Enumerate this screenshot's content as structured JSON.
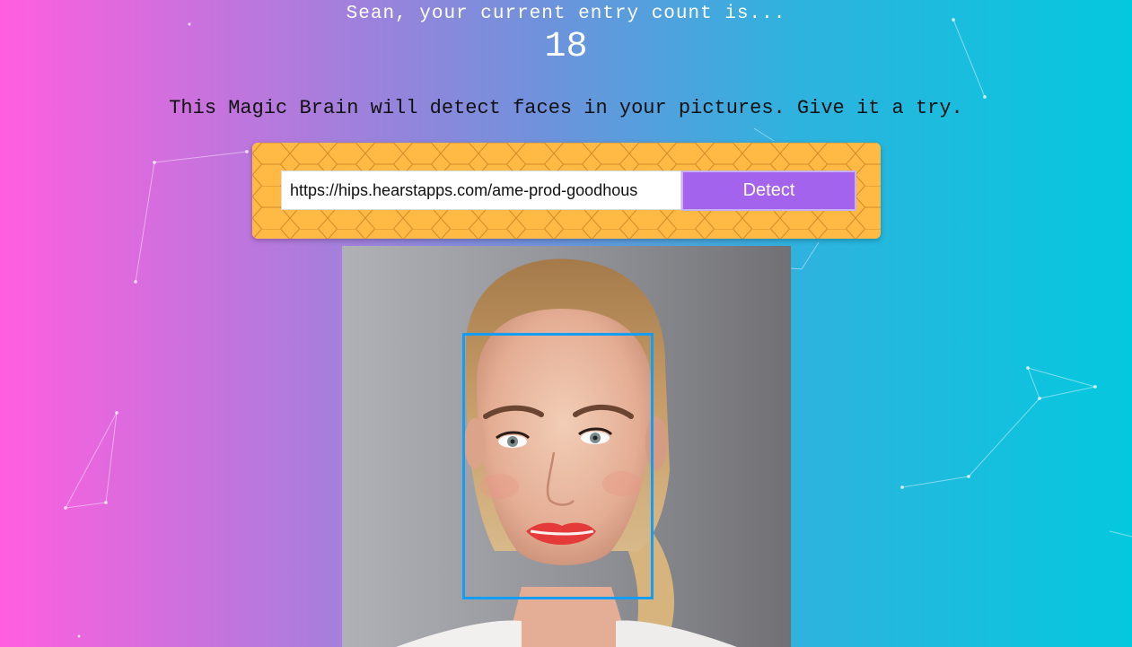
{
  "header": {
    "greeting": "Sean, your current entry count is...",
    "entry_count": "18"
  },
  "tagline": "This Magic Brain will detect faces in your pictures. Give it a try.",
  "form": {
    "url_value": "https://hips.hearstapps.com/ame-prod-goodhous",
    "detect_label": "Detect"
  },
  "colors": {
    "gradient_left": "#ff5edf",
    "gradient_right": "#04c8de",
    "panel": "#ffba45",
    "button": "#a463ec",
    "face_box": "#149df2"
  }
}
